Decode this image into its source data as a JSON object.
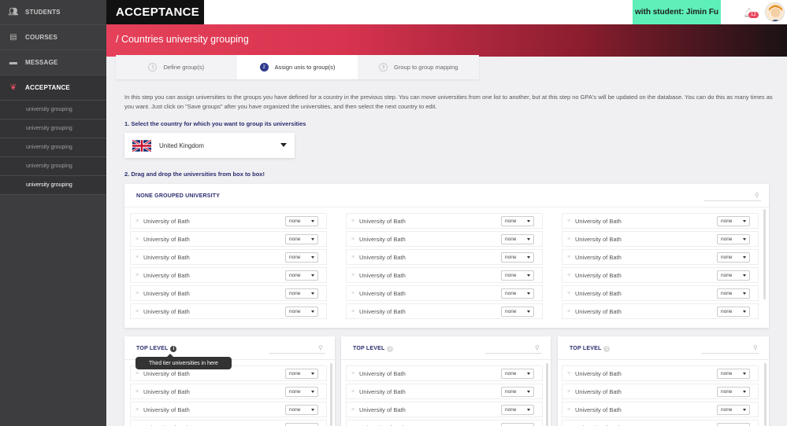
{
  "sidebar": {
    "main": [
      {
        "label": "STUDENTS",
        "icon": "users-icon"
      },
      {
        "label": "COURSES",
        "icon": "book-icon"
      },
      {
        "label": "MESSAGE",
        "icon": "chat-icon"
      },
      {
        "label": "ACCEPTANCE",
        "icon": "handshake-icon"
      }
    ],
    "sub": [
      "university grouping",
      "university grouping",
      "university grouping",
      "university grouping",
      "university grouping"
    ]
  },
  "topbar": {
    "brand": "ACCEPTANCE",
    "student": "with student: Jimin Fu",
    "notification_count": "12"
  },
  "band": {
    "title": "/ Countries university grouping"
  },
  "steps": [
    {
      "num": "1",
      "label": "Define group(s)"
    },
    {
      "num": "2",
      "label": "Assign unis to group(s)"
    },
    {
      "num": "3",
      "label": "Group to group mapping"
    }
  ],
  "intro": "In this step you can assign universities to the groups you have defined for a country in the previous step. You can move universities from one list to another, but at this step no GPA's will be updated on the database. You can do this as many times as you want. Just click on \"Save groups\" after you have organized the universities, and then select the next country to edit.",
  "step1_label": "1. Select the country for which you want to group its universities",
  "country": "United Kingdom",
  "step2_label": "2. Drag and drop the universities from box to box!",
  "none_panel": {
    "title": "NONE GROUPED UNIVERSITY",
    "uni_name": "University of Bath",
    "select_value": "none"
  },
  "top_panels": [
    {
      "title": "TOP LEVEL"
    },
    {
      "title": "TOP LEVEL"
    },
    {
      "title": "TOP LEVEL"
    }
  ],
  "tooltip": "Third tier universities in here",
  "uni_name": "University of Bath",
  "select_value": "none",
  "colors": {
    "accent": "#e6415a",
    "student_box": "#5ef0b8",
    "navy": "#2b2d6e"
  }
}
